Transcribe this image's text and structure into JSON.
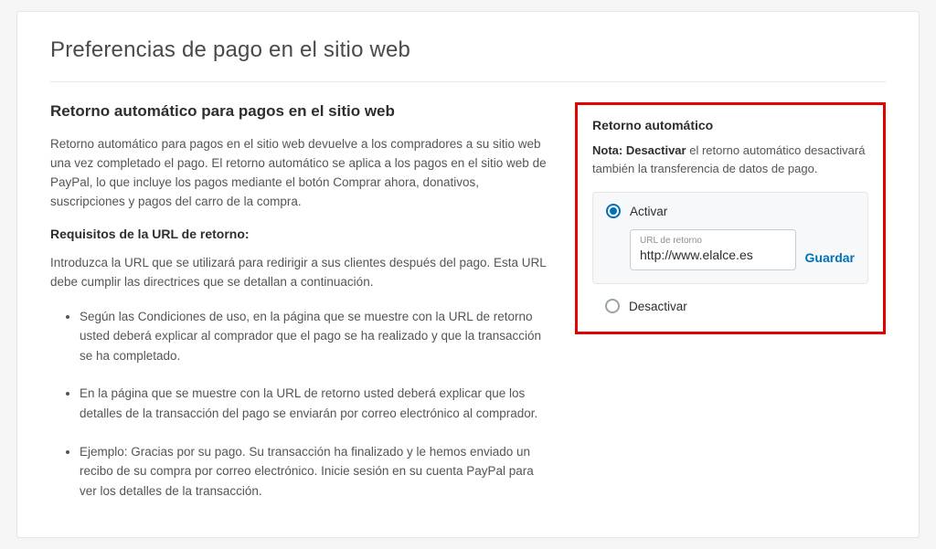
{
  "page_title": "Preferencias de pago en el sitio web",
  "left": {
    "section_heading": "Retorno automático para pagos en el sitio web",
    "intro": "Retorno automático para pagos en el sitio web devuelve a los compradores a su sitio web una vez completado el pago. El retorno automático se aplica a los pagos en el sitio web de PayPal, lo que incluye los pagos mediante el botón Comprar ahora, donativos, suscripciones y pagos del carro de la compra.",
    "req_heading": "Requisitos de la URL de retorno:",
    "req_intro": "Introduzca la URL que se utilizará para redirigir a sus clientes después del pago. Esta URL debe cumplir las directrices que se detallan a continuación.",
    "bullets": [
      "Según las Condiciones de uso, en la página que se muestre con la URL de retorno usted deberá explicar al comprador que el pago se ha realizado y que la transacción se ha completado.",
      "En la página que se muestre con la URL de retorno usted deberá explicar que los detalles de la transacción del pago se enviarán por correo electrónico al comprador.",
      "Ejemplo: Gracias por su pago. Su transacción ha finalizado y le hemos enviado un recibo de su compra por correo electrónico. Inicie sesión en su cuenta PayPal para ver los detalles de la transacción."
    ]
  },
  "right": {
    "title": "Retorno automático",
    "note_label": "Nota: Desactivar",
    "note_text": " el retorno automático desactivará también la transferencia de datos de pago.",
    "option_on": "Activar",
    "option_off": "Desactivar",
    "url_label": "URL de retorno",
    "url_value": "http://www.elalce.es",
    "save": "Guardar"
  }
}
